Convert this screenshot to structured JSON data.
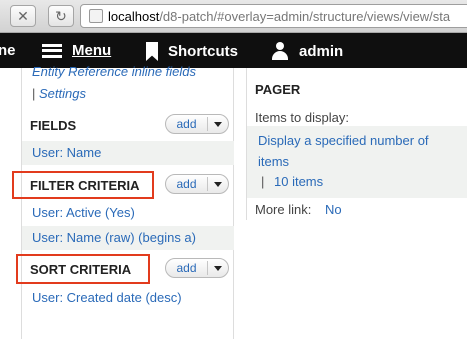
{
  "browser": {
    "url_host": "localhost",
    "url_path": "/d8-patch/#overlay=admin/structure/views/view/sta"
  },
  "toolbar": {
    "home_fragment": "ne",
    "menu_label": "Menu",
    "shortcuts_label": "Shortcuts",
    "user_label": "admin"
  },
  "left": {
    "cut_link": "Entity Reference inline fields",
    "settings_separator": "|",
    "settings_link": "Settings",
    "fields": {
      "heading": "FIELDS",
      "add_label": "add",
      "items": [
        "User: Name"
      ]
    },
    "filter": {
      "heading": "FILTER CRITERIA",
      "add_label": "add",
      "items": [
        "User: Active (Yes)",
        "User: Name (raw) (begins a)"
      ]
    },
    "sort": {
      "heading": "SORT CRITERIA",
      "add_label": "add",
      "items": [
        "User: Created date (desc)"
      ]
    }
  },
  "right": {
    "pager": {
      "heading": "PAGER",
      "items_label": "Items to display:",
      "display_link": "Display a specified number of items",
      "separator": "|",
      "count_link": "10 items",
      "more_label": "More link:",
      "more_value": "No"
    }
  },
  "colors": {
    "highlight": "#e23b1d",
    "link": "#2a6ab8",
    "toolbar_bg": "#0f0f0f"
  }
}
